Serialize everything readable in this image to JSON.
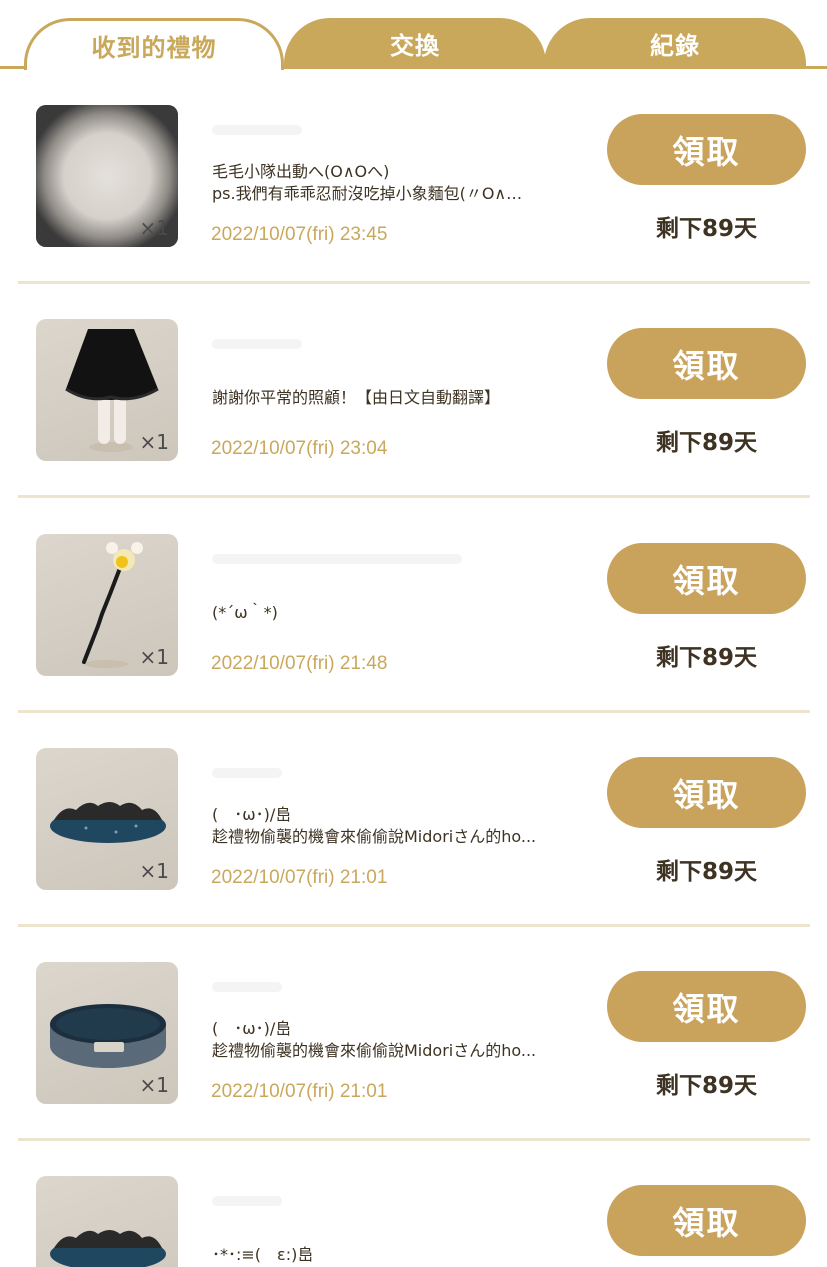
{
  "tabs": [
    {
      "label": "收到的禮物",
      "active": true
    },
    {
      "label": "交換",
      "active": false
    },
    {
      "label": "紀錄",
      "active": false
    }
  ],
  "gifts": [
    {
      "icon": "glowing-orb-icon",
      "qty": "×1",
      "message": [
        "毛毛小隊出動へ(O∧Oへ)",
        "ps.我們有乖乖忍耐沒吃掉小象麵包(〃O∧…"
      ],
      "date": "2022/10/07(fri) 23:45",
      "claim": "領取",
      "remaining": "剩下89天"
    },
    {
      "icon": "black-skirt-icon",
      "qty": "×1",
      "message": [
        "謝謝你平常的照顧！【由日文自動翻譯】"
      ],
      "date": "2022/10/07(fri) 23:04",
      "claim": "領取",
      "remaining": "剩下89天"
    },
    {
      "icon": "light-wand-icon",
      "qty": "×1",
      "message": [
        "(*´ω｀*)"
      ],
      "date": "2022/10/07(fri) 21:48",
      "claim": "領取",
      "remaining": "剩下89天"
    },
    {
      "icon": "blue-rug-icon",
      "qty": "×1",
      "message": [
        "(　･ω･)/峊",
        "趁禮物偷襲的機會來偷偷說Midoriさん的ho..."
      ],
      "date": "2022/10/07(fri) 21:01",
      "claim": "領取",
      "remaining": "剩下89天"
    },
    {
      "icon": "round-tray-icon",
      "qty": "×1",
      "message": [
        "(　･ω･)/峊",
        "趁禮物偷襲的機會來偷偷說Midoriさん的ho..."
      ],
      "date": "2022/10/07(fri) 21:01",
      "claim": "領取",
      "remaining": "剩下89天"
    },
    {
      "icon": "blue-rug-icon",
      "qty": "",
      "message": [
        "･*･:≡(　ε:)峊"
      ],
      "date": "",
      "claim": "領取",
      "remaining": ""
    }
  ],
  "colors": {
    "accent": "#c9a85c",
    "text": "#3e3323",
    "divider": "#ece4cd"
  }
}
